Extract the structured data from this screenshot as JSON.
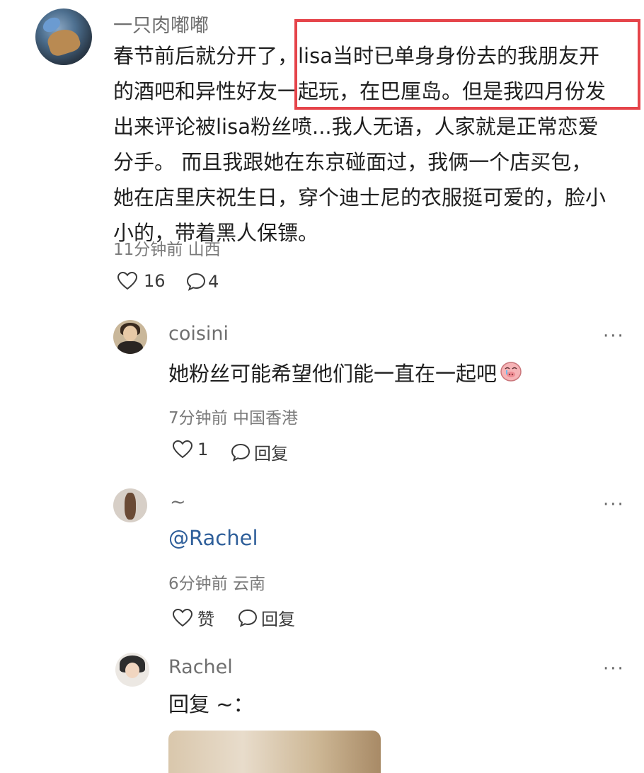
{
  "main_comment": {
    "username": "一只肉嘟嘟",
    "lines": [
      "春节前后就分开了，lisa当时已单身身份去的我朋友开",
      "的酒吧和异性好友一起玩，在巴厘岛。但是我四月份发",
      "出来评论被lisa粉丝喷...我人无语，人家就是正常恋爱",
      "分手。 而且我跟她在东京碰面过，我俩一个店买包，",
      "她在店里庆祝生日，穿个迪士尼的衣服挺可爱的，脸小",
      "小的，带着黑人保镖。"
    ],
    "meta": "11分钟前 山西",
    "likes": "16",
    "replies": "4"
  },
  "replies": [
    {
      "username": "coisini",
      "text": "她粉丝可能希望他们能一直在一起吧",
      "meta": "7分钟前 中国香港",
      "likes": "1",
      "reply_label": "回复",
      "more": "···"
    },
    {
      "username": "~",
      "text": "@Rachel",
      "meta": "6分钟前 云南",
      "likes": "赞",
      "reply_label": "回复",
      "more": "···"
    },
    {
      "username": "Rachel",
      "text": "回复 ~：",
      "more": "···"
    }
  ],
  "colors": {
    "highlight_border": "#e5444a",
    "mention": "#2f5f9a"
  }
}
